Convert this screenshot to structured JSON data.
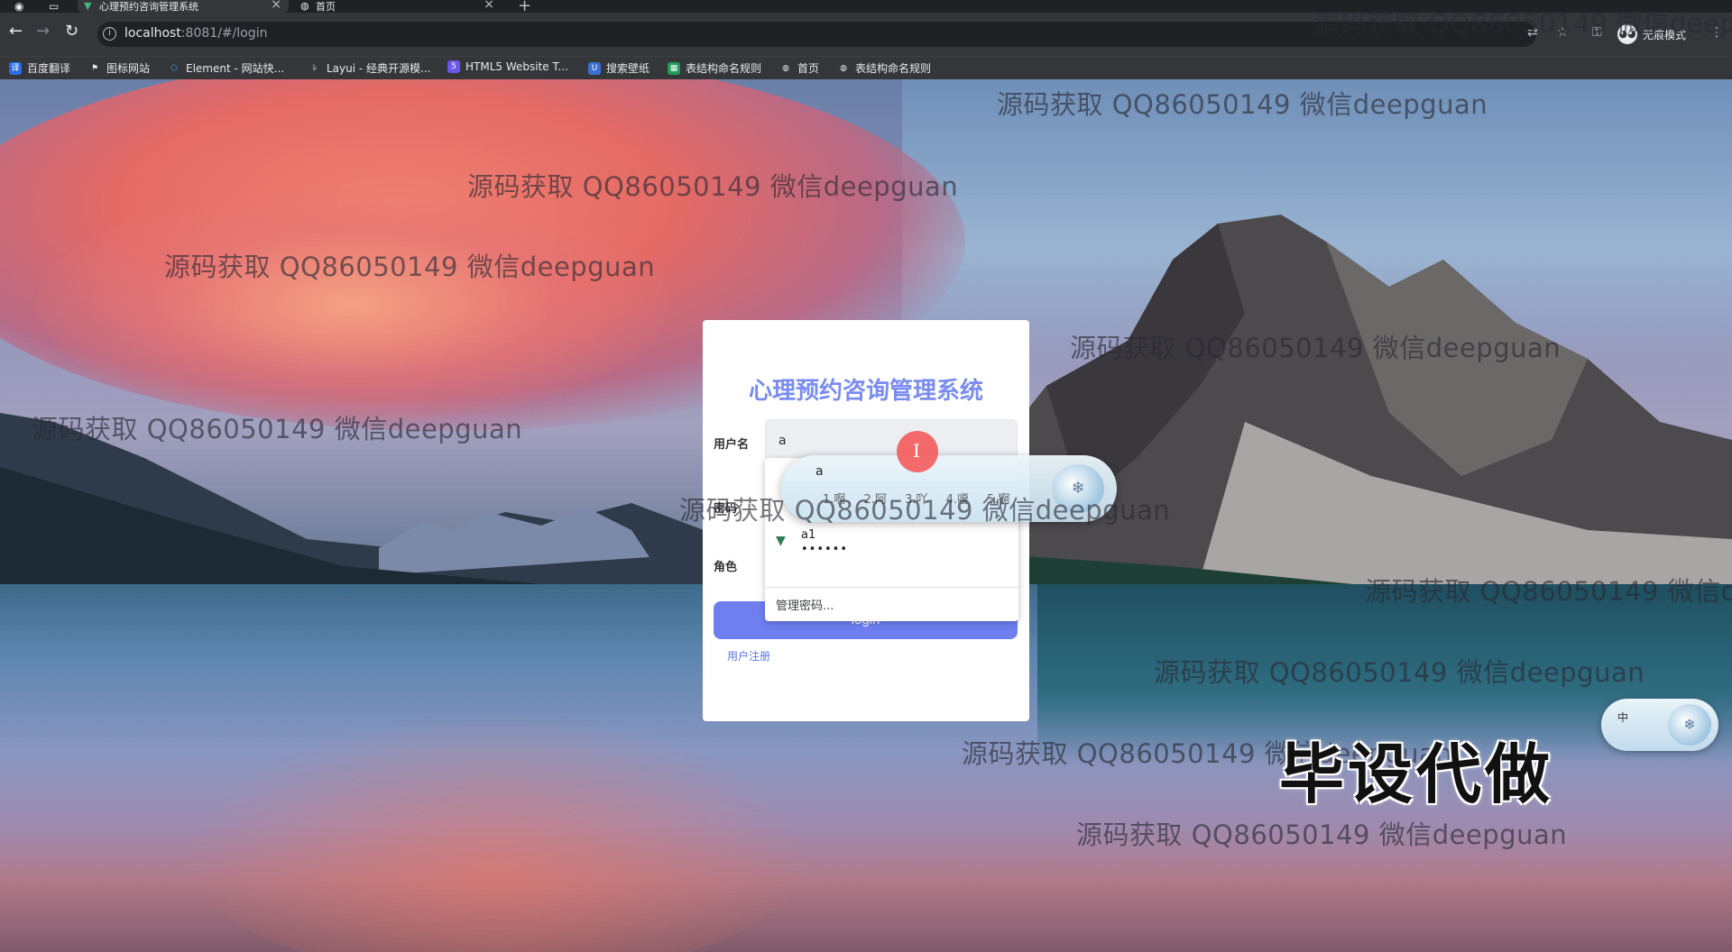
{
  "browser": {
    "tabs": [
      {
        "title": "心理预约咨询管理系统",
        "favicon": "vue-icon",
        "active": true
      },
      {
        "title": "首页",
        "favicon": "globe-icon",
        "active": false
      }
    ],
    "new_tab": "+",
    "url_host": "localhost",
    "url_rest": ":8081/#/login",
    "incognito_label": "无痕模式"
  },
  "bookmarks": [
    {
      "label": "百度翻译",
      "icon": "translate-icon",
      "color": "#2b6de6"
    },
    {
      "label": "图标网站",
      "icon": "flag-icon",
      "color": "#5f6368"
    },
    {
      "label": "Element - 网站快...",
      "icon": "element-icon",
      "color": "#409eff"
    },
    {
      "label": "Layui - 经典开源模...",
      "icon": "layui-icon",
      "color": "#5f6368"
    },
    {
      "label": "HTML5 Website T...",
      "icon": "html5-icon",
      "color": "#6b57e8"
    },
    {
      "label": "搜索壁纸",
      "icon": "wallpaper-icon",
      "color": "#3b6fd6"
    },
    {
      "label": "表结构命名规则",
      "icon": "sheet-icon",
      "color": "#1e9e5a"
    },
    {
      "label": "首页",
      "icon": "globe-icon",
      "color": "#5f6368"
    },
    {
      "label": "表结构命名规则",
      "icon": "globe-icon",
      "color": "#5f6368"
    }
  ],
  "watermark": {
    "text": "源码获取 QQ86050149 微信deepguan",
    "banner": "毕设代做"
  },
  "login": {
    "title": "心理预约咨询管理系统",
    "username_label": "用户名",
    "username_value": "a",
    "password_label": "密码",
    "role_label": "角色",
    "login_button": "login",
    "register_link": "用户注册"
  },
  "autofill": {
    "username": "a1",
    "password_mask": "••••••",
    "manage": "管理密码..."
  },
  "ime": {
    "composition": "a",
    "candidates": "1.啊 2.阿 3.吖 4.嗄 5.锕",
    "mini_label": "中"
  },
  "colors": {
    "accent": "#6f7ff0",
    "title": "#7a8cf0",
    "link": "#5a74e8"
  }
}
